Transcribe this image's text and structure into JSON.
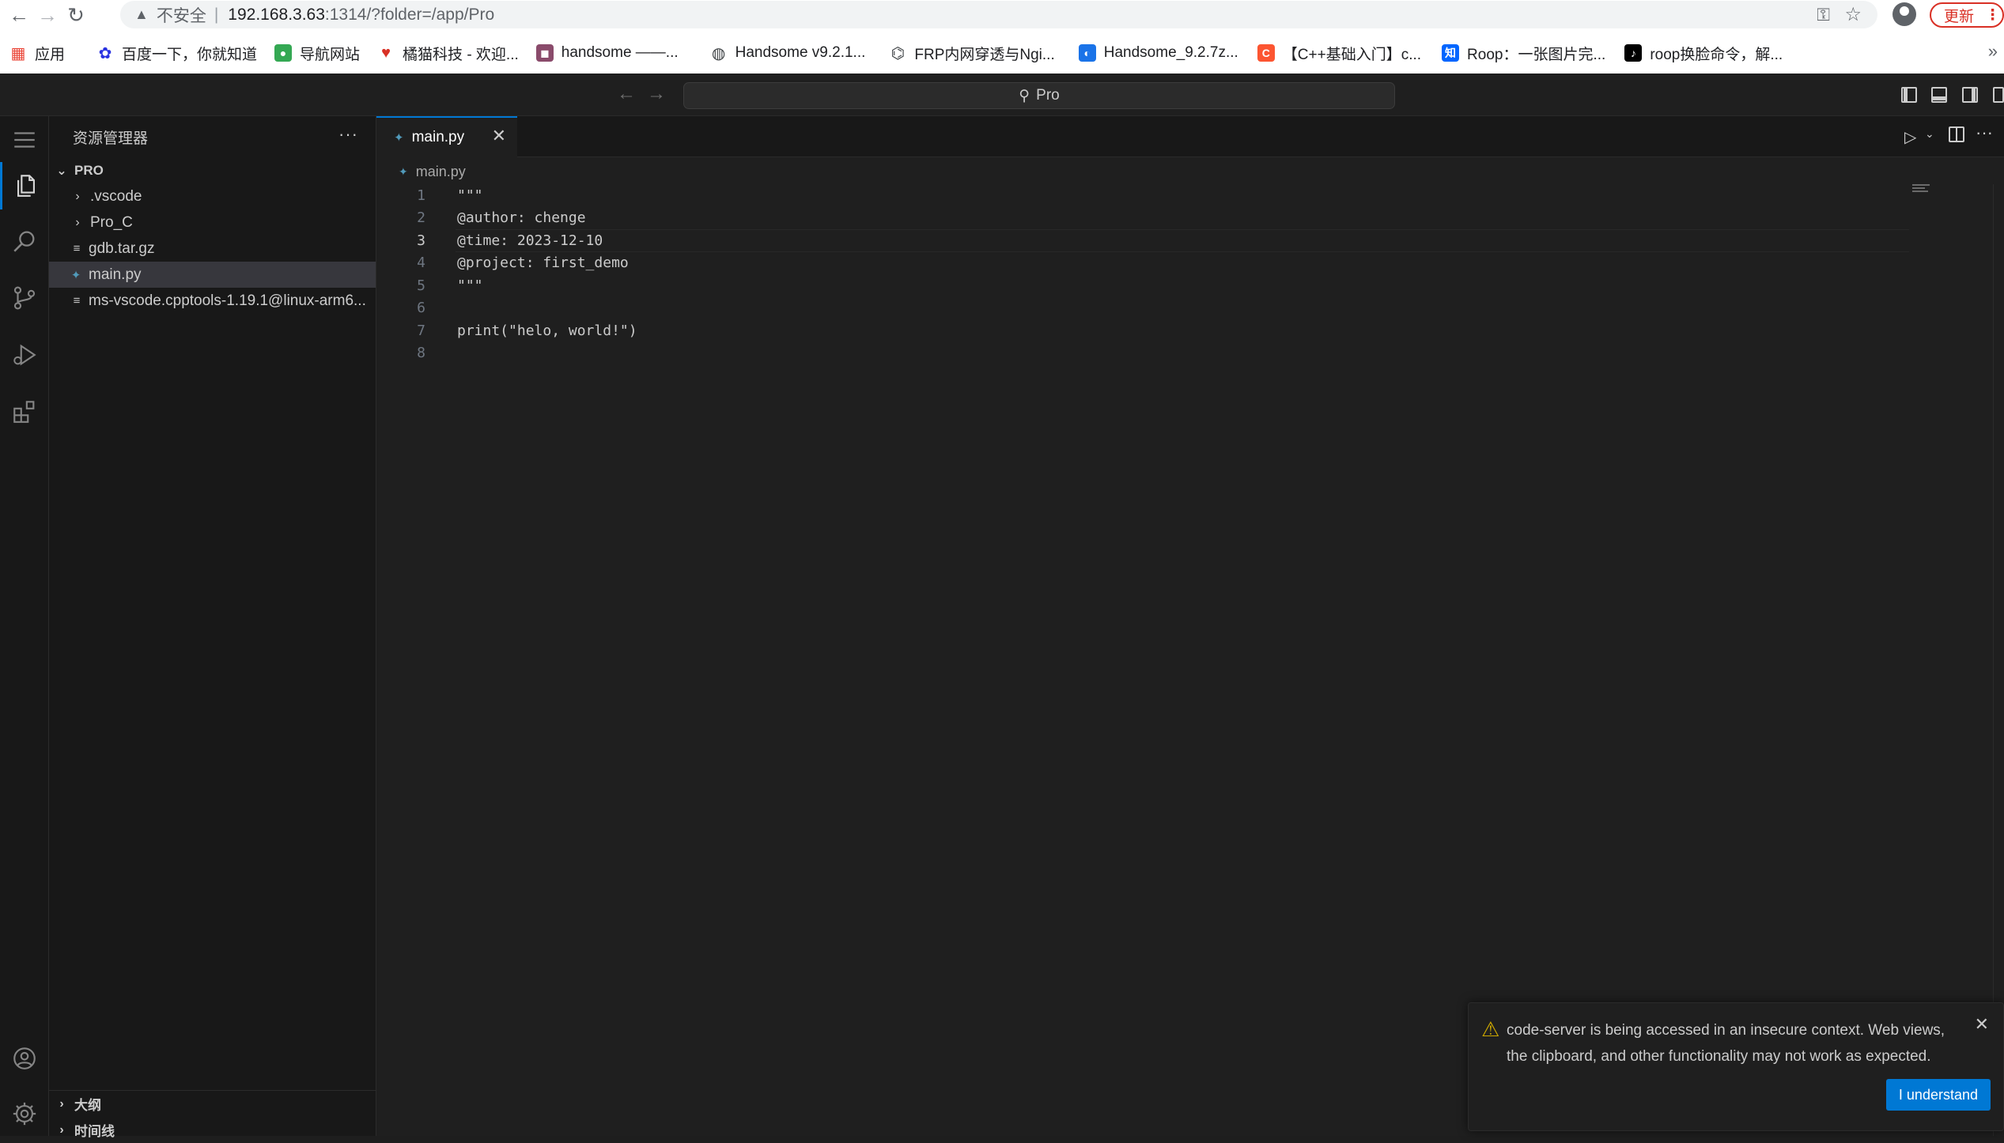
{
  "browser": {
    "address": {
      "warning_label": "不安全",
      "host": "192.168.3.63",
      "path": ":1314/?folder=/app/Pro"
    },
    "update_label": "更新",
    "bookmarks": [
      {
        "label": "应用",
        "icon": "apps-grid-icon",
        "color": "#ea4335"
      },
      {
        "label": "百度一下，你就知道",
        "icon": "baidu-paw-icon",
        "color": "#2932e1"
      },
      {
        "label": "导航网站",
        "icon": "globe-green-icon",
        "color": "#34a853"
      },
      {
        "label": "橘猫科技 - 欢迎...",
        "icon": "heart-icon",
        "color": "#d93025"
      },
      {
        "label": "handsome ——...",
        "icon": "avatar-thumb-icon",
        "color": "#8a4b6b"
      },
      {
        "label": "Handsome v9.2.1...",
        "icon": "globe-icon",
        "color": "#3c4043"
      },
      {
        "label": "FRP内网穿透与Ngi...",
        "icon": "network-icon",
        "color": "#3c4043"
      },
      {
        "label": "Handsome_9.2.7z...",
        "icon": "edge-wave-icon",
        "color": "#1a73e8"
      },
      {
        "label": "【C++基础入门】c...",
        "icon": "csdn-c-icon",
        "color": "#fc5531"
      },
      {
        "label": "Roop：一张图片完...",
        "icon": "zhihu-icon",
        "color": "#0066ff"
      },
      {
        "label": "roop换脸命令，解...",
        "icon": "tiktok-icon",
        "color": "#000000"
      }
    ]
  },
  "vscode": {
    "command_center": "Pro",
    "sidebar": {
      "title": "资源管理器",
      "root": "PRO",
      "items": [
        {
          "label": ".vscode",
          "kind": "folder"
        },
        {
          "label": "Pro_C",
          "kind": "folder"
        },
        {
          "label": "gdb.tar.gz",
          "kind": "file"
        },
        {
          "label": "main.py",
          "kind": "python",
          "selected": true
        },
        {
          "label": "ms-vscode.cpptools-1.19.1@linux-arm6...",
          "kind": "file"
        }
      ],
      "bottom_sections": [
        "大纲",
        "时间线"
      ]
    },
    "editor": {
      "tab_label": "main.py",
      "breadcrumb": "main.py",
      "current_line": 3,
      "lines": [
        {
          "n": "1",
          "text": "\"\"\""
        },
        {
          "n": "2",
          "text": "@author: chenge"
        },
        {
          "n": "3",
          "text": "@time: 2023-12-10"
        },
        {
          "n": "4",
          "text": "@project: first_demo"
        },
        {
          "n": "5",
          "text": "\"\"\""
        },
        {
          "n": "6",
          "text": ""
        },
        {
          "n": "7",
          "text": "print(\"helo, world!\")"
        },
        {
          "n": "8",
          "text": ""
        }
      ]
    },
    "notification": {
      "message": "code-server is being accessed in an insecure context. Web views, the clipboard, and other functionality may not work as expected.",
      "button": "I understand"
    },
    "colors": {
      "accent": "#0078d4",
      "warning": "#cca700",
      "python": "#519aba"
    }
  }
}
